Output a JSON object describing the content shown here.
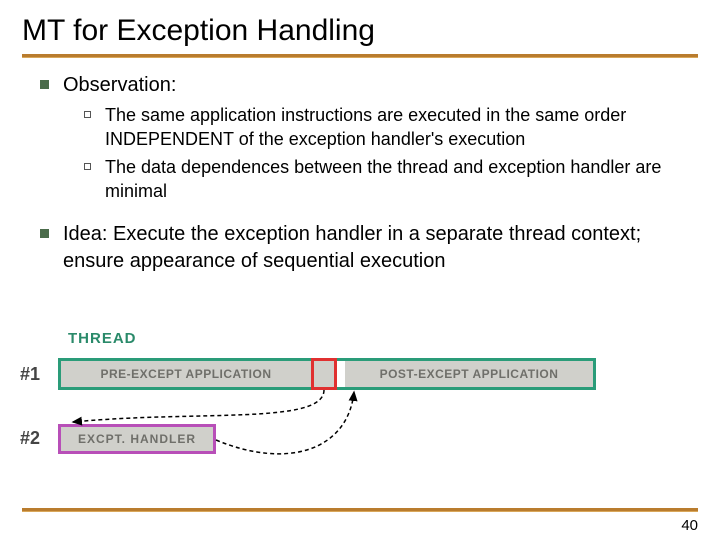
{
  "title": "MT for Exception Handling",
  "bullets": {
    "observation_label": "Observation:",
    "sub1": "The same application instructions are executed in the same order INDEPENDENT of the exception handler's execution",
    "sub2": "The data dependences between the thread and exception handler are minimal",
    "idea": "Idea: Execute the exception handler in a separate thread context; ensure appearance of sequential execution"
  },
  "diagram": {
    "thread_label": "THREAD",
    "row1_label": "#1",
    "row2_label": "#2",
    "pre_app": "PRE-EXCEPT APPLICATION",
    "post_app": "POST-EXCEPT APPLICATION",
    "handler": "EXCPT. HANDLER"
  },
  "page_number": "40"
}
